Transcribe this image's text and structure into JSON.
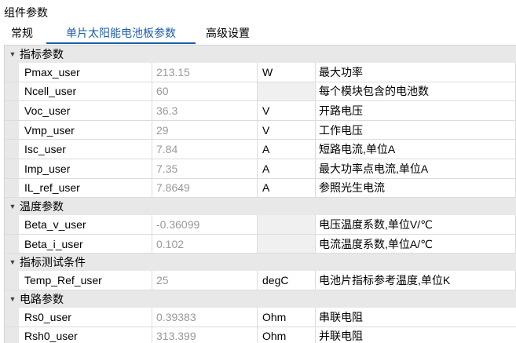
{
  "panel": {
    "title": "组件参数"
  },
  "tabs": [
    {
      "label": "常规",
      "active": false
    },
    {
      "label": "单片太阳能电池板参数",
      "active": true
    },
    {
      "label": "高级设置",
      "active": false
    }
  ],
  "groups": [
    {
      "label": "指标参数",
      "toggle_icon": "collapse-triangle",
      "rows": [
        {
          "name": "Pmax_user",
          "value": "213.15",
          "unit": "W",
          "desc": "最大功率"
        },
        {
          "name": "Ncell_user",
          "value": "60",
          "unit": "",
          "desc": "每个模块包含的电池数"
        },
        {
          "name": "Voc_user",
          "value": "36.3",
          "unit": "V",
          "desc": "开路电压"
        },
        {
          "name": "Vmp_user",
          "value": "29",
          "unit": "V",
          "desc": "工作电压"
        },
        {
          "name": "Isc_user",
          "value": "7.84",
          "unit": "A",
          "desc": "短路电流,单位A"
        },
        {
          "name": "Imp_user",
          "value": "7.35",
          "unit": "A",
          "desc": "最大功率点电流,单位A"
        },
        {
          "name": "IL_ref_user",
          "value": "7.8649",
          "unit": "A",
          "desc": "参照光生电流"
        }
      ]
    },
    {
      "label": "温度参数",
      "toggle_icon": "collapse-triangle",
      "rows": [
        {
          "name": "Beta_v_user",
          "value": "-0.36099",
          "unit": "",
          "desc": "电压温度系数,单位V/℃"
        },
        {
          "name": "Beta_i_user",
          "value": "0.102",
          "unit": "",
          "desc": "电流温度系数,单位A/℃"
        }
      ]
    },
    {
      "label": "指标测试条件",
      "toggle_icon": "collapse-triangle",
      "rows": [
        {
          "name": "Temp_Ref_user",
          "value": "25",
          "unit": "degC",
          "desc": "电池片指标参考温度,单位K"
        }
      ]
    },
    {
      "label": "电路参数",
      "toggle_icon": "collapse-triangle",
      "rows": [
        {
          "name": "Rs0_user",
          "value": "0.39383",
          "unit": "Ohm",
          "desc": "串联电阻"
        },
        {
          "name": "Rsh0_user",
          "value": "313.399",
          "unit": "Ohm",
          "desc": "并联电阻"
        }
      ]
    }
  ]
}
